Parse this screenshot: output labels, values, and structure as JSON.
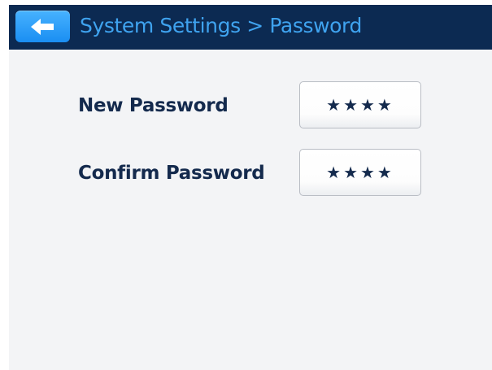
{
  "header": {
    "back_icon": "arrow-left-icon",
    "title": "System Settings > Password"
  },
  "fields": [
    {
      "label": "New Password",
      "value": "★★★★"
    },
    {
      "label": "Confirm Password",
      "value": "★★★★"
    }
  ],
  "colors": {
    "header_bg": "#0c2a52",
    "title_text": "#3fa3ef",
    "back_button": "#2a9cf7",
    "label_text": "#142a4d",
    "screen_bg": "#f3f4f6"
  }
}
